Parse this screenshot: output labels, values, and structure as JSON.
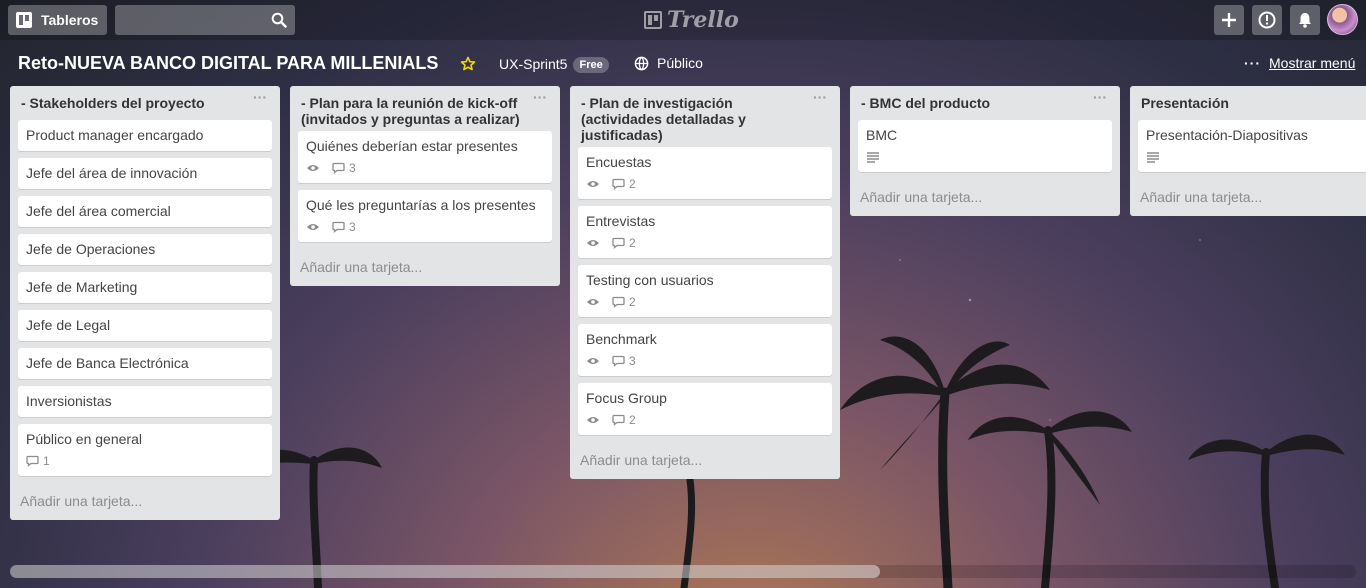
{
  "header": {
    "boards_label": "Tableros",
    "search_placeholder": "",
    "logo_text": "Trello"
  },
  "board": {
    "title": "Reto-NUEVA BANCO DIGITAL PARA MILLENIALS",
    "team": "UX-Sprint5",
    "team_badge": "Free",
    "visibility": "Público",
    "menu_label": "Mostrar menú"
  },
  "lists": [
    {
      "title": "- Stakeholders del proyecto",
      "cards": [
        {
          "title": "Product manager encargado"
        },
        {
          "title": "Jefe del área de innovación"
        },
        {
          "title": "Jefe del área comercial"
        },
        {
          "title": "Jefe de Operaciones"
        },
        {
          "title": "Jefe de Marketing"
        },
        {
          "title": "Jefe de Legal"
        },
        {
          "title": "Jefe de Banca Electrónica"
        },
        {
          "title": "Inversionistas"
        },
        {
          "title": "Público en general",
          "comments": "1"
        }
      ],
      "add_label": "Añadir una tarjeta..."
    },
    {
      "title": "- Plan para la reunión de kick-off (invitados y preguntas a realizar)",
      "cards": [
        {
          "title": "Quiénes deberían estar presentes",
          "comments": "3"
        },
        {
          "title": "Qué les preguntarías a los presentes",
          "comments": "3"
        }
      ],
      "add_label": "Añadir una tarjeta..."
    },
    {
      "title": "- Plan de investigación (actividades detalladas y justificadas)",
      "cards": [
        {
          "title": "Encuestas",
          "comments": "2"
        },
        {
          "title": "Entrevistas",
          "comments": "2"
        },
        {
          "title": "Testing con usuarios",
          "comments": "2"
        },
        {
          "title": "Benchmark",
          "comments": "3"
        },
        {
          "title": "Focus Group",
          "comments": "2"
        }
      ],
      "add_label": "Añadir una tarjeta..."
    },
    {
      "title": "- BMC del producto",
      "cards": [
        {
          "title": "BMC"
        }
      ],
      "add_label": "Añadir una tarjeta..."
    },
    {
      "title": "Presentación",
      "cards": [
        {
          "title": "Presentación-Diapositivas"
        }
      ],
      "add_label": "Añadir una tarjeta..."
    }
  ]
}
